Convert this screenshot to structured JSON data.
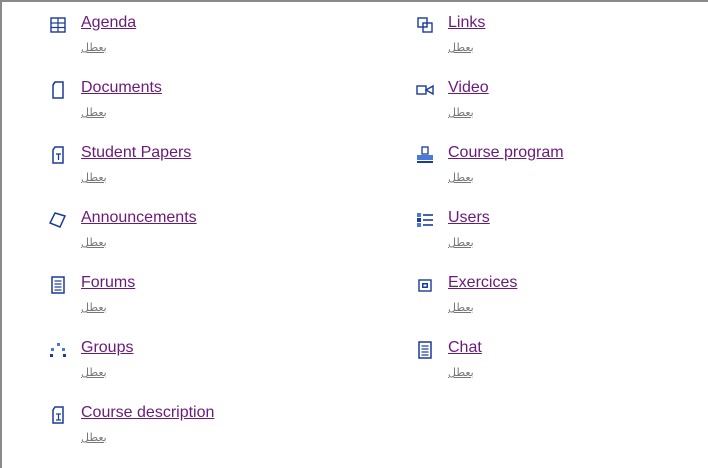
{
  "tools": {
    "agenda": {
      "label": "Agenda",
      "sub": "بعطل",
      "icon": "calendar-grid-icon"
    },
    "documents": {
      "label": "Documents",
      "sub": "بعطل",
      "icon": "document-icon"
    },
    "student_papers": {
      "label": "Student Papers",
      "sub": "بعطل",
      "icon": "student-paper-icon"
    },
    "announcements": {
      "label": "Announcements",
      "sub": "بعطل",
      "icon": "announcement-icon"
    },
    "forums": {
      "label": "Forums",
      "sub": "بعطل",
      "icon": "forum-icon"
    },
    "groups": {
      "label": "Groups",
      "sub": "بعطل",
      "icon": "groups-icon"
    },
    "course_description": {
      "label": "Course description",
      "sub": "بعطل",
      "icon": "course-description-icon"
    },
    "links": {
      "label": "Links",
      "sub": "بعطل",
      "icon": "links-icon"
    },
    "video": {
      "label": "Video",
      "sub": "بعطل",
      "icon": "video-icon"
    },
    "course_program": {
      "label": "Course program",
      "sub": "بعطل",
      "icon": "course-program-icon"
    },
    "users": {
      "label": "Users",
      "sub": "بعطل",
      "icon": "users-icon"
    },
    "exercices": {
      "label": "Exercices",
      "sub": "بعطل",
      "icon": "exercises-icon"
    },
    "chat": {
      "label": "Chat",
      "sub": "بعطل",
      "icon": "chat-icon"
    }
  },
  "colors": {
    "link": "#6b1a7a",
    "icon_blue": "#1a3a9c",
    "icon_light_blue": "#4a7ad8",
    "frame": "#8a8a8a"
  }
}
